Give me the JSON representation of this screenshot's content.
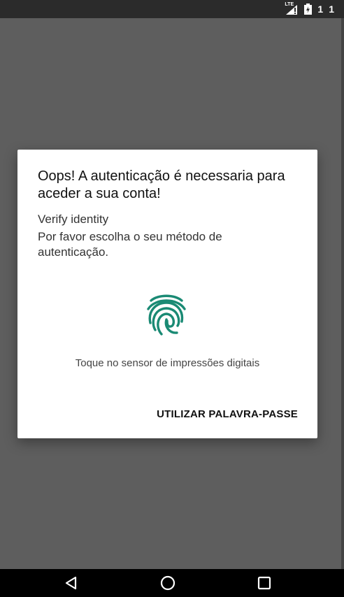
{
  "status_bar": {
    "network_label": "LTE",
    "indicators": [
      "1",
      "1"
    ],
    "icons": [
      "signal-icon",
      "battery-charging-icon"
    ]
  },
  "dialog": {
    "title": "Oops! A autenticação é necessaria para aceder a sua conta!",
    "subtitle": "Verify identity",
    "description": "Por favor escolha o seu método de autenticação.",
    "fingerprint_icon": "fingerprint-icon",
    "sensor_hint": "Toque no sensor de impressões digitais",
    "password_button_label": "UTILIZAR PALAVRA-PASSE",
    "accent_color": "#1a8a74"
  },
  "nav_bar": {
    "buttons": [
      "back-icon",
      "home-icon",
      "recents-icon"
    ]
  }
}
